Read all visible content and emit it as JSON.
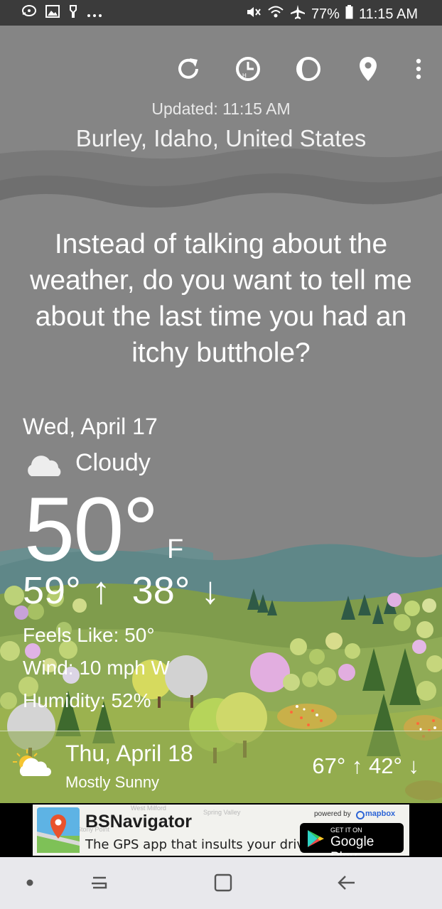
{
  "status_bar": {
    "icons_left": [
      "chat-icon",
      "image-icon",
      "ambient-icon",
      "more-dots-icon"
    ],
    "icons_right": [
      "mute-icon",
      "wifi-icon",
      "airplane-icon"
    ],
    "battery": "77%",
    "time": "11:15 AM"
  },
  "toolbar": {
    "icons": [
      "refresh-icon",
      "hourly-clock-icon",
      "moon-phase-icon",
      "location-pin-icon",
      "overflow-menu-icon"
    ]
  },
  "header": {
    "updated": "Updated: 11:15 AM",
    "location": "Burley, Idaho, United States"
  },
  "quip": "Instead of talking about the weather, do you want to tell me about the last time you had an itchy butthole?",
  "current": {
    "date": "Wed, April 17",
    "condition": "Cloudy",
    "temperature": "50°",
    "unit": "F",
    "high": "59° ↑",
    "low": "38° ↓",
    "feels_like": "Feels Like: 50°",
    "wind": "Wind: 10 mph W",
    "humidity": "Humidity: 52%"
  },
  "forecast": {
    "date": "Thu, April 18",
    "condition": "Mostly Sunny",
    "hilo": "67° ↑  42° ↓"
  },
  "ad": {
    "title": "BSNavigator",
    "subtitle": "The GPS app that insults your driving.",
    "powered_by": "powered by",
    "mapbox": "mapbox",
    "badge_small": "GET IT ON",
    "badge_big": "Google Play",
    "map_labels": [
      "West Milford",
      "Spring Valley",
      "Stony Point"
    ]
  },
  "colors": {
    "sky": "#858585",
    "accent_text": "#ffffff"
  }
}
